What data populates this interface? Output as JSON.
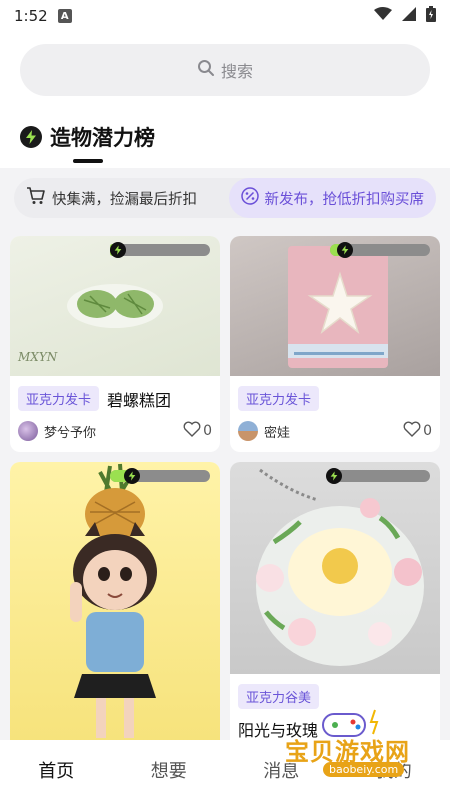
{
  "status": {
    "time": "1:52",
    "app_badge": "A"
  },
  "search": {
    "placeholder": "搜索"
  },
  "section": {
    "title": "造物潜力榜"
  },
  "promos": [
    {
      "label": "快集满，捡漏最后折扣"
    },
    {
      "label": "新发布，抢低折扣购买席"
    }
  ],
  "cards": [
    {
      "tag": "亚克力发卡",
      "name": "碧螺糕团",
      "user": "梦兮予你",
      "likes": "0",
      "progress": 0.05,
      "image_text": "MXYN"
    },
    {
      "tag": "亚克力发卡",
      "name": "",
      "user": "密娃",
      "likes": "0",
      "progress": 0.15
    },
    {
      "tag": "",
      "name": "",
      "user": "",
      "likes": "",
      "progress": 0.22
    },
    {
      "tag": "亚克力谷美",
      "name": "阳光与玫瑰",
      "user": "",
      "likes": "",
      "progress": 0.02
    }
  ],
  "nav": {
    "items": [
      "首页",
      "想要",
      "消息",
      "我的"
    ]
  },
  "watermark": {
    "text": "宝贝游戏网",
    "url": "baobeiy.com"
  },
  "colors": {
    "accent": "#6a55d8",
    "progress_fill": "#9be050",
    "tag_bg": "#ece8fb"
  }
}
